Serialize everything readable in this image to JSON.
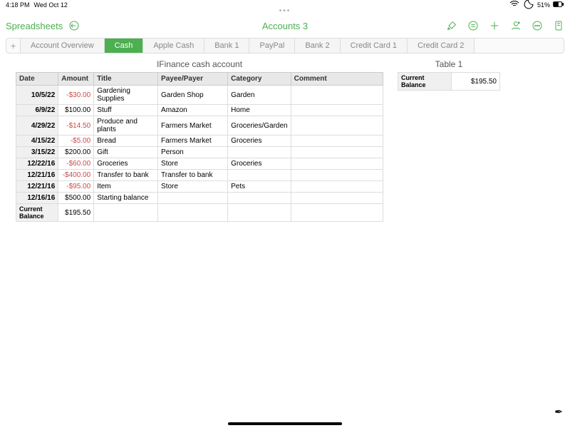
{
  "status": {
    "time": "4:18 PM",
    "date": "Wed Oct 12",
    "battery": "51%"
  },
  "header": {
    "back": "Spreadsheets",
    "title": "Accounts 3"
  },
  "tabs": [
    "Account Overview",
    "Cash",
    "Apple Cash",
    "Bank 1",
    "PayPal",
    "Bank 2",
    "Credit Card 1",
    "Credit Card 2"
  ],
  "active_tab": 1,
  "table1": {
    "title": "IFinance cash account",
    "headers": [
      "Date",
      "Amount",
      "Title",
      "Payee/Payer",
      "Category",
      "Comment"
    ],
    "rows": [
      {
        "date": "10/5/22",
        "amount": "-$30.00",
        "neg": true,
        "title": "Gardening Supplies",
        "payee": "Garden Shop",
        "category": "Garden",
        "comment": ""
      },
      {
        "date": "6/9/22",
        "amount": "$100.00",
        "neg": false,
        "title": "Stuff",
        "payee": "Amazon",
        "category": "Home",
        "comment": ""
      },
      {
        "date": "4/29/22",
        "amount": "-$14.50",
        "neg": true,
        "title": "Produce and plants",
        "payee": "Farmers Market",
        "category": "Groceries/Garden",
        "comment": ""
      },
      {
        "date": "4/15/22",
        "amount": "-$5.00",
        "neg": true,
        "title": "Bread",
        "payee": "Farmers  Market",
        "category": "Groceries",
        "comment": ""
      },
      {
        "date": "3/15/22",
        "amount": "$200.00",
        "neg": false,
        "title": "Gift",
        "payee": "Person",
        "category": "",
        "comment": ""
      },
      {
        "date": "12/22/16",
        "amount": "-$60.00",
        "neg": true,
        "title": "Groceries",
        "payee": "Store",
        "category": "Groceries",
        "comment": ""
      },
      {
        "date": "12/21/16",
        "amount": "-$400.00",
        "neg": true,
        "title": "Transfer to bank",
        "payee": "Transfer to bank",
        "category": "",
        "comment": ""
      },
      {
        "date": "12/21/16",
        "amount": "-$95.00",
        "neg": true,
        "title": "Item",
        "payee": "Store",
        "category": "Pets",
        "comment": ""
      },
      {
        "date": "12/16/16",
        "amount": "$500.00",
        "neg": false,
        "title": "Starting balance",
        "payee": "",
        "category": "",
        "comment": ""
      }
    ],
    "footer_label": "Current Balance",
    "footer_value": "$195.50"
  },
  "table2": {
    "title": "Table 1",
    "label": "Current Balance",
    "value": "$195.50"
  }
}
